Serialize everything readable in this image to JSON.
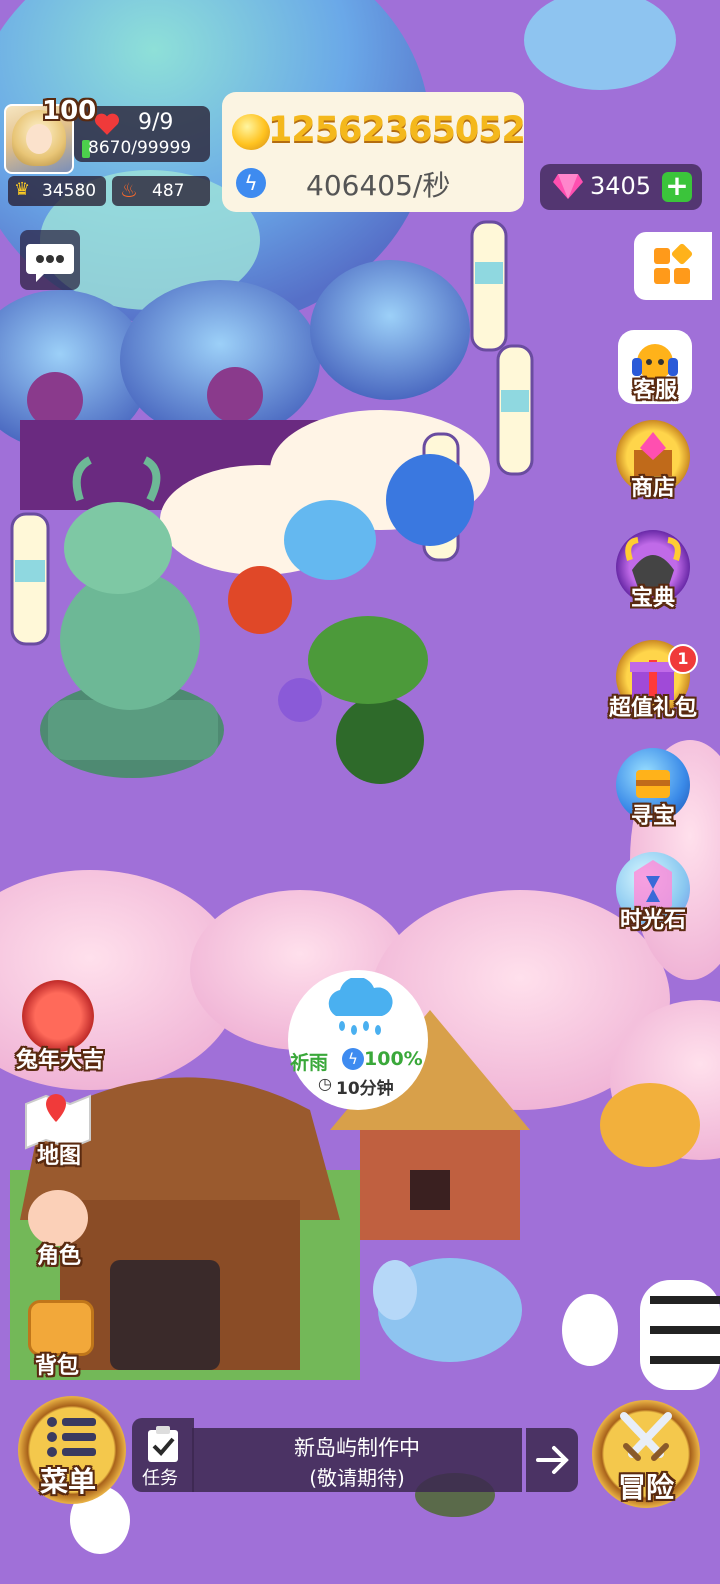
{
  "player": {
    "level": "100",
    "hp": "9/9",
    "exp": "8670/99999",
    "crowns": "34580",
    "fire": "487"
  },
  "currency": {
    "gold": "12562365052",
    "rate": "406405/秒",
    "gems": "3405"
  },
  "right_menu": [
    {
      "label": "客服",
      "icon": "headset-icon"
    },
    {
      "label": "商店",
      "icon": "treasure-chest-icon"
    },
    {
      "label": "宝典",
      "icon": "horned-helmet-icon"
    },
    {
      "label": "超值礼包",
      "icon": "gift-box-icon",
      "badge": "1"
    },
    {
      "label": "寻宝",
      "icon": "treasure-ball-icon"
    },
    {
      "label": "时光石",
      "icon": "hourglass-crystal-icon"
    }
  ],
  "left_menu": [
    {
      "label": "兔年大吉",
      "icon": "rabbit-mask-icon"
    },
    {
      "label": "地图",
      "icon": "map-pin-icon"
    },
    {
      "label": "角色",
      "icon": "character-face-icon"
    },
    {
      "label": "背包",
      "icon": "backpack-icon"
    }
  ],
  "weather": {
    "label": "祈雨",
    "percent": "100%",
    "time": "10分钟"
  },
  "bottom": {
    "menu": "菜单",
    "task": "任务",
    "status_line1": "新岛屿制作中",
    "status_line2": "(敬请期待)",
    "adventure": "冒险"
  },
  "colors": {
    "ground": "#a070d8",
    "gold_text": "#f4b81c",
    "panel": "#fbf4e2",
    "gem": "#ff4fb0",
    "plus": "#3bc43b"
  }
}
